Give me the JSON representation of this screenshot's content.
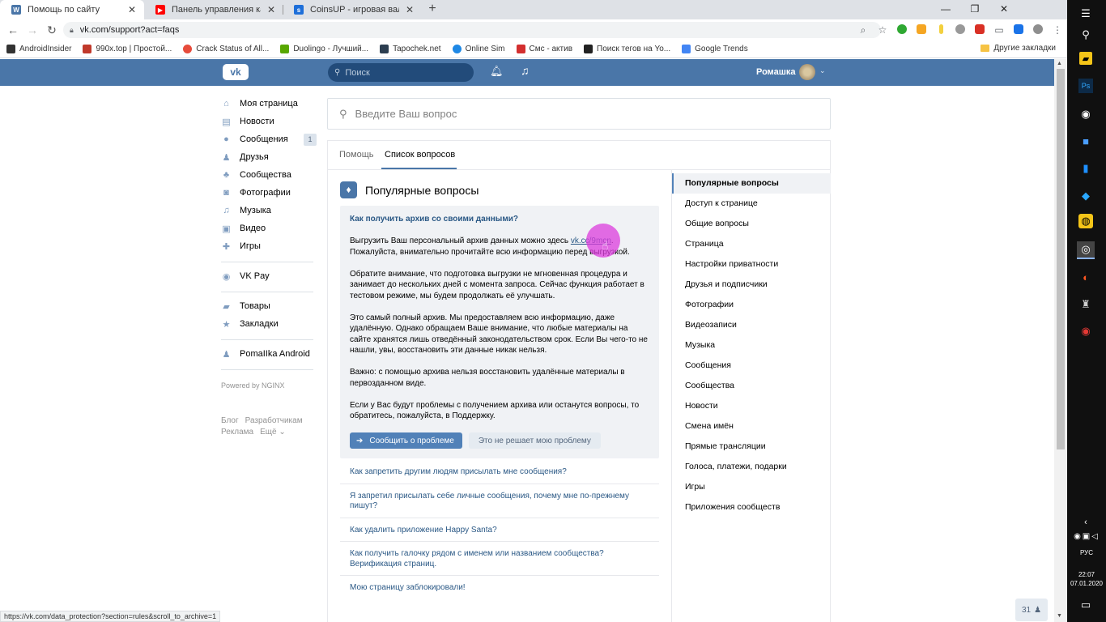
{
  "browser": {
    "tabs": [
      {
        "title": "Помощь по сайту",
        "color": "#4a76a8",
        "glyph": "vk"
      },
      {
        "title": "Панель управления каналом - ",
        "color": "#ff0000",
        "glyph": "▶"
      },
      {
        "title": "CoinsUP - игровая валюта, пре",
        "color": "#1e6fd9",
        "glyph": "s"
      }
    ],
    "new_tab": "+",
    "url": "vk.com/support?act=faqs",
    "bookmarks": [
      {
        "label": "AndroidInsider",
        "color": "#333"
      },
      {
        "label": "990x.top | Простой...",
        "color": "#c0392b"
      },
      {
        "label": "Crack Status of All...",
        "color": "#e74c3c"
      },
      {
        "label": "Duolingo - Лучший...",
        "color": "#58a700"
      },
      {
        "label": "Tapochek.net",
        "color": "#2c3e50"
      },
      {
        "label": "Online Sim",
        "color": "#1e88e5"
      },
      {
        "label": "Смс - актив",
        "color": "#d32f2f"
      },
      {
        "label": "Поиск тегов на Yo...",
        "color": "#222"
      },
      {
        "label": "Google Trends",
        "color": "#4285f4"
      }
    ],
    "other_bookmarks": "Другие закладки",
    "status_url": "https://vk.com/data_protection?section=rules&scroll_to_archive=1"
  },
  "vk_header": {
    "logo": "vk",
    "search_placeholder": "Поиск",
    "user_name": "Ромашка"
  },
  "left_nav": {
    "items": [
      {
        "label": "Моя страница",
        "icon": "home-icon",
        "glyph": "⌂"
      },
      {
        "label": "Новости",
        "icon": "news-icon",
        "glyph": "▤"
      },
      {
        "label": "Сообщения",
        "icon": "messages-icon",
        "glyph": "●",
        "count": "1"
      },
      {
        "label": "Друзья",
        "icon": "friends-icon",
        "glyph": "♟"
      },
      {
        "label": "Сообщества",
        "icon": "groups-icon",
        "glyph": "♣"
      },
      {
        "label": "Фотографии",
        "icon": "photos-icon",
        "glyph": "◙"
      },
      {
        "label": "Музыка",
        "icon": "music-icon",
        "glyph": "♫"
      },
      {
        "label": "Видео",
        "icon": "video-icon",
        "glyph": "▣"
      },
      {
        "label": "Игры",
        "icon": "games-icon",
        "glyph": "✚"
      }
    ],
    "vkpay": "VK Pay",
    "items2": [
      {
        "label": "Товары",
        "icon": "market-icon",
        "glyph": "▰"
      },
      {
        "label": "Закладки",
        "icon": "bookmarks-icon",
        "glyph": "★"
      }
    ],
    "app": "PomaIIka Android",
    "powered": "Powered by NGINX",
    "footer": {
      "blog": "Блог",
      "dev": "Разработчикам",
      "ads": "Реклама",
      "more": "Ещё ⌄"
    }
  },
  "support": {
    "question_placeholder": "Введите Ваш вопрос",
    "tabs": [
      "Помощь",
      "Список вопросов"
    ],
    "popular_title": "Популярные вопросы",
    "open_question": {
      "title": "Как получить архив со своими данными?",
      "p1_text": "Выгрузить Ваш персональный архив данных можно здесь ",
      "p1_link": "vk.cc/9mcn",
      "p1_tail": ". Пожалуйста, внимательно прочитайте всю информацию перед выгрузкой.",
      "p2": "Обратите внимание, что подготовка выгрузки не мгновенная процедура и занимает до нескольких дней с момента запроса. Сейчас функция работает в тестовом режиме, мы будем продолжать её улучшать.",
      "p3": "Это самый полный архив. Мы предоставляем всю информацию, даже удалённую. Однако обращаем Ваше внимание, что любые материалы на сайте хранятся лишь отведённый законодательством срок. Если Вы чего-то не нашли, увы, восстановить эти данные никак нельзя.",
      "p4": "Важно: с помощью архива нельзя восстановить удалённые материалы в первозданном виде.",
      "p5": "Если у Вас будут проблемы с получением архива или останутся вопросы, то обратитесь, пожалуйста, в Поддержку.",
      "report_button": "Сообщить о проблеме",
      "not_solved_button": "Это не решает мою проблему"
    },
    "questions": [
      "Как запретить другим людям присылать мне сообщения?",
      "Я запретил присылать себе личные сообщения, почему мне по-прежнему пишут?",
      "Как удалить приложение Happy Santa?",
      "Как получить галочку рядом с именем или названием сообщества? Верификация страниц.",
      "Мою страницу заблокировали!"
    ],
    "categories": [
      "Популярные вопросы",
      "Доступ к странице",
      "Общие вопросы",
      "Страница",
      "Настройки приватности",
      "Друзья и подписчики",
      "Фотографии",
      "Видеозаписи",
      "Музыка",
      "Сообщения",
      "Сообщества",
      "Новости",
      "Смена имён",
      "Прямые трансляции",
      "Голоса, платежи, подарки",
      "Игры",
      "Приложения сообществ"
    ],
    "counter": "31"
  },
  "taskbar": {
    "lang": "РУС",
    "time": "22:07",
    "date": "07.01.2020"
  }
}
